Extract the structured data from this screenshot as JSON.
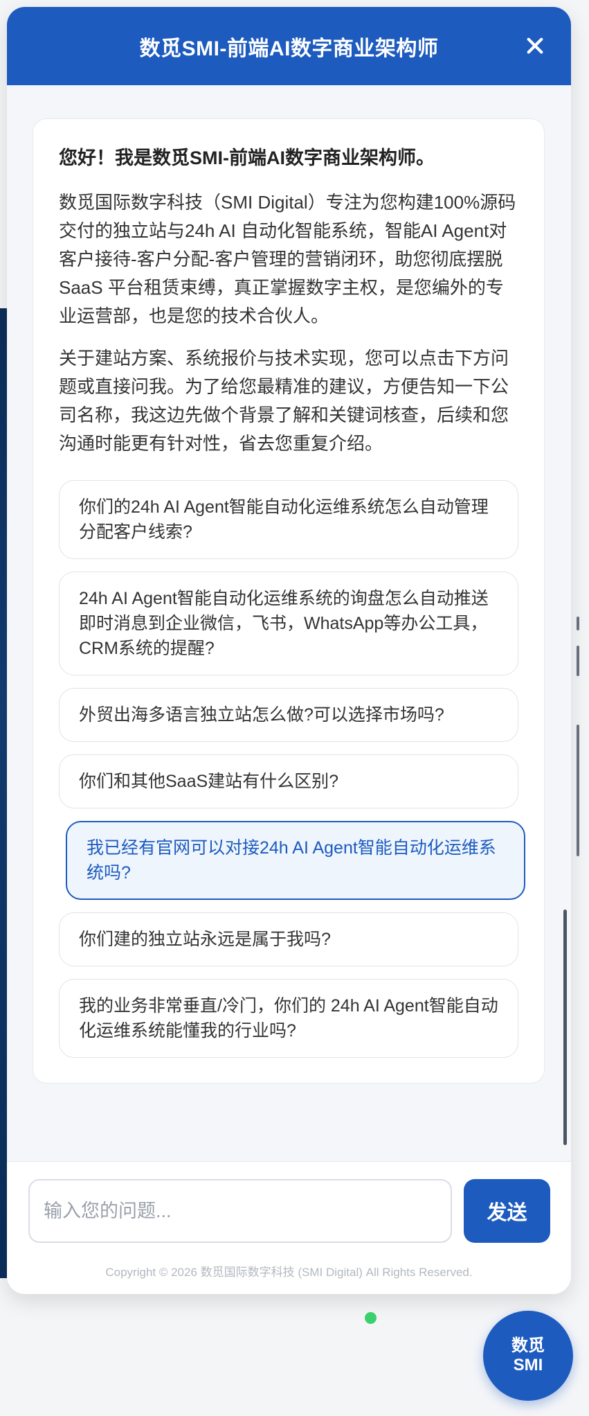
{
  "header": {
    "title": "数觅SMI-前端AI数字商业架构师"
  },
  "message": {
    "greeting": "您好！我是数觅SMI-前端AI数字商业架构师。",
    "paragraph1": "数觅国际数字科技（SMI Digital）专注为您构建100%源码交付的独立站与24h AI 自动化智能系统，智能AI Agent对客户接待-客户分配-客户管理的营销闭环，助您彻底摆脱 SaaS 平台租赁束缚，真正掌握数字主权，是您编外的专业运营部，也是您的技术合伙人。",
    "paragraph2": "关于建站方案、系统报价与技术实现，您可以点击下方问题或直接问我。为了给您最精准的建议，方便告知一下公司名称，我这边先做个背景了解和关键词核查，后续和您沟通时能更有针对性，省去您重复介绍。"
  },
  "questions": [
    "你们的24h AI Agent智能自动化运维系统怎么自动管理分配客户线索?",
    "24h AI Agent智能自动化运维系统的询盘怎么自动推送即时消息到企业微信，飞书，WhatsApp等办公工具，CRM系统的提醒?",
    "外贸出海多语言独立站怎么做?可以选择市场吗?",
    "你们和其他SaaS建站有什么区别?",
    "我已经有官网可以对接24h AI Agent智能自动化运维系统吗?",
    "你们建的独立站永远是属于我吗?",
    "我的业务非常垂直/冷门，你们的 24h AI Agent智能自动化运维系统能懂我的行业吗?"
  ],
  "input": {
    "placeholder": "输入您的问题...",
    "value": "",
    "send_label": "发送"
  },
  "footer": {
    "copyright": "Copyright © 2026 数觅国际数字科技 (SMI Digital) All Rights Reserved."
  },
  "fab": {
    "line1": "数觅",
    "line2": "SMI"
  },
  "colors": {
    "brand": "#1d5bbf",
    "active_bg": "#eef5fd",
    "online": "#3ccf6e"
  }
}
